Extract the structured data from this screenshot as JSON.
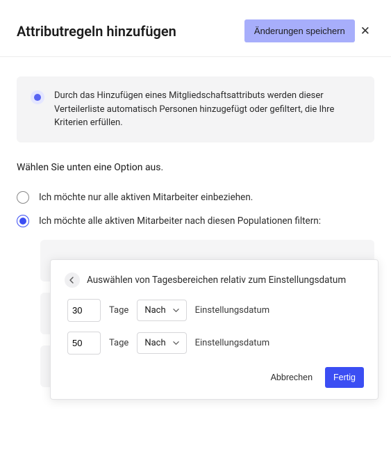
{
  "header": {
    "title": "Attributregeln hinzufügen",
    "save_label": "Änderungen speichern"
  },
  "banner": {
    "text": "Durch das Hinzufügen eines Mitgliedschaftsattributs werden dieser Verteilerliste automatisch Personen hinzugefügt oder gefiltert, die Ihre Kriterien erfüllen."
  },
  "choose_label": "Wählen Sie unten eine Option aus.",
  "options": {
    "only_active": "Ich möchte nur alle aktiven Mitarbeiter einbeziehen.",
    "filter_active": "Ich möchte alle aktiven Mitarbeiter nach diesen Populationen filtern:"
  },
  "popup": {
    "title": "Auswählen von Tagesbereichen relativ zum Einstellungsdatum",
    "rows": [
      {
        "value": "30",
        "unit": "Tage",
        "direction": "Nach",
        "suffix": "Einstellungsdatum"
      },
      {
        "value": "50",
        "unit": "Tage",
        "direction": "Nach",
        "suffix": "Einstellungsdatum"
      }
    ],
    "cancel": "Abbrechen",
    "done": "Fertig"
  }
}
